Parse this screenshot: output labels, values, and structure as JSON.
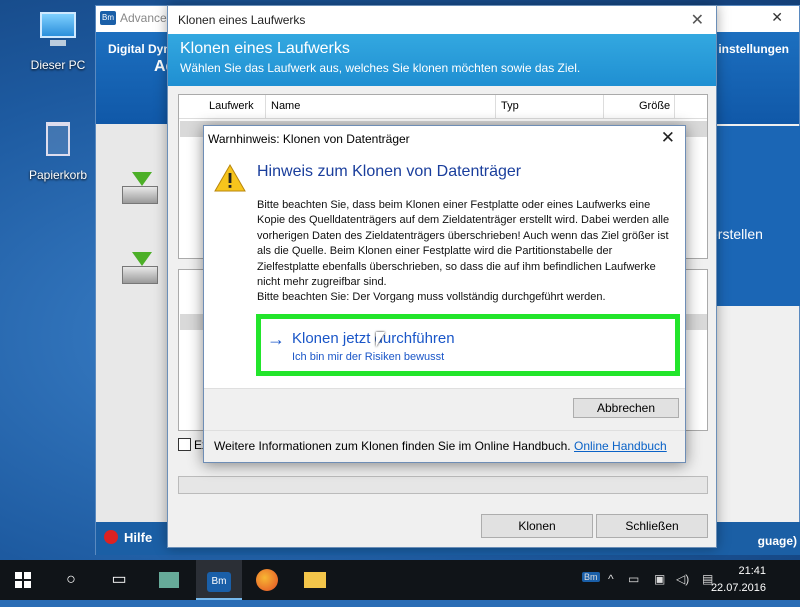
{
  "desktop": {
    "icons": [
      {
        "label": "Dieser PC"
      },
      {
        "label": "Papierkorb"
      }
    ]
  },
  "bg_window": {
    "title": "Advance",
    "logo_text": "Bm",
    "header_line1": "Digital Dyn",
    "header_line2": "Ad",
    "header_right": "instellungen",
    "side_right_text": "erstellen",
    "help": "Hilfe",
    "lang": "guage)",
    "close_glyph": "✕"
  },
  "clone_window": {
    "title": "Klonen eines Laufwerks",
    "heading": "Klonen eines Laufwerks",
    "subheading": "Wählen Sie das Laufwerk aus, welches Sie klonen möchten sowie das Ziel.",
    "columns": [
      "Laufwerk",
      "Name",
      "Typ",
      "Größe"
    ],
    "checkbox_label": "Ex",
    "buttons": {
      "clone": "Klonen",
      "close": "Schließen"
    }
  },
  "warning_dialog": {
    "title": "Warnhinweis: Klonen von Datenträger",
    "main_instruction": "Hinweis zum Klonen von Datenträger",
    "paragraphs": [
      "Bitte beachten Sie, dass beim Klonen einer Festplatte oder eines Laufwerks eine Kopie des Quelldatenträgers auf dem Zieldatenträger erstellt wird. Dabei werden alle vorherigen Daten des Zieldatenträgers überschrieben! Auch wenn das Ziel größer ist als die Quelle. Beim Klonen einer Festplatte wird die Partitionstabelle der Zielfestplatte ebenfalls überschrieben, so dass die auf ihm befindlichen Laufwerke nicht mehr zugreifbar sind.",
      "Bitte beachten Sie: Der Vorgang muss vollständig durchgeführt werden."
    ],
    "command_link": {
      "title": "Klonen jetzt durchführen",
      "note": "Ich bin mir der Risiken bewusst",
      "highlight_color": "#22e52b"
    },
    "cancel_label": "Abbrechen",
    "footer_text": "Weitere Informationen zum Klonen finden Sie im Online Handbuch.",
    "footer_link": "Online Handbuch"
  },
  "taskbar": {
    "time": "21:41",
    "date": "22.07.2016",
    "app_logo_text": "Bm",
    "tray_logo_text": "Bm"
  }
}
